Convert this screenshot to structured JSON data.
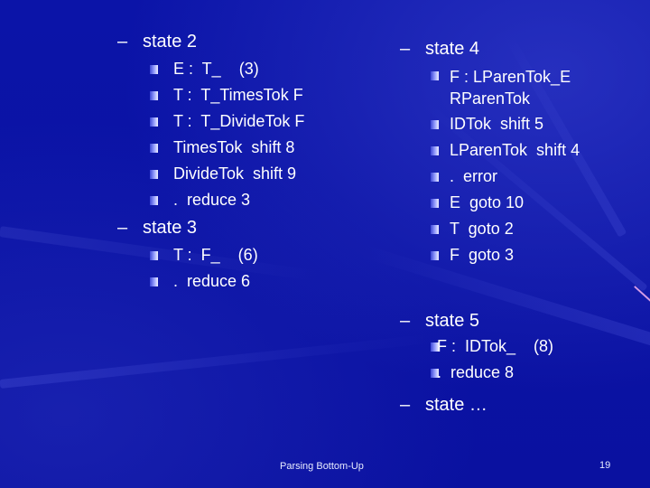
{
  "slide": {
    "footer": "Parsing Bottom-Up",
    "page_number": "19",
    "background_color": "#0a12a6",
    "text_color": "#ffffff"
  },
  "states": [
    {
      "label": "state 2",
      "items": [
        "E :  T_    (3)",
        "T :  T_TimesTok F",
        "T :  T_DivideTok F",
        "TimesTok  shift 8",
        "DivideTok  shift 9",
        ".  reduce 3"
      ]
    },
    {
      "label": "state 3",
      "items": [
        "T :  F_    (6)",
        ".  reduce 6"
      ]
    },
    {
      "label": "state 4",
      "items": [
        "F :  LParenTok_E RParenTok",
        "IDTok  shift 5",
        "LParenTok  shift 4",
        ".  error",
        "E  goto 10",
        "T  goto 2",
        "F  goto 3"
      ]
    },
    {
      "label": "state 5",
      "items": [
        " F :  IDTok_    (8)",
        " .  reduce 8"
      ]
    },
    {
      "label": "state …",
      "items": []
    }
  ],
  "dash": "–"
}
